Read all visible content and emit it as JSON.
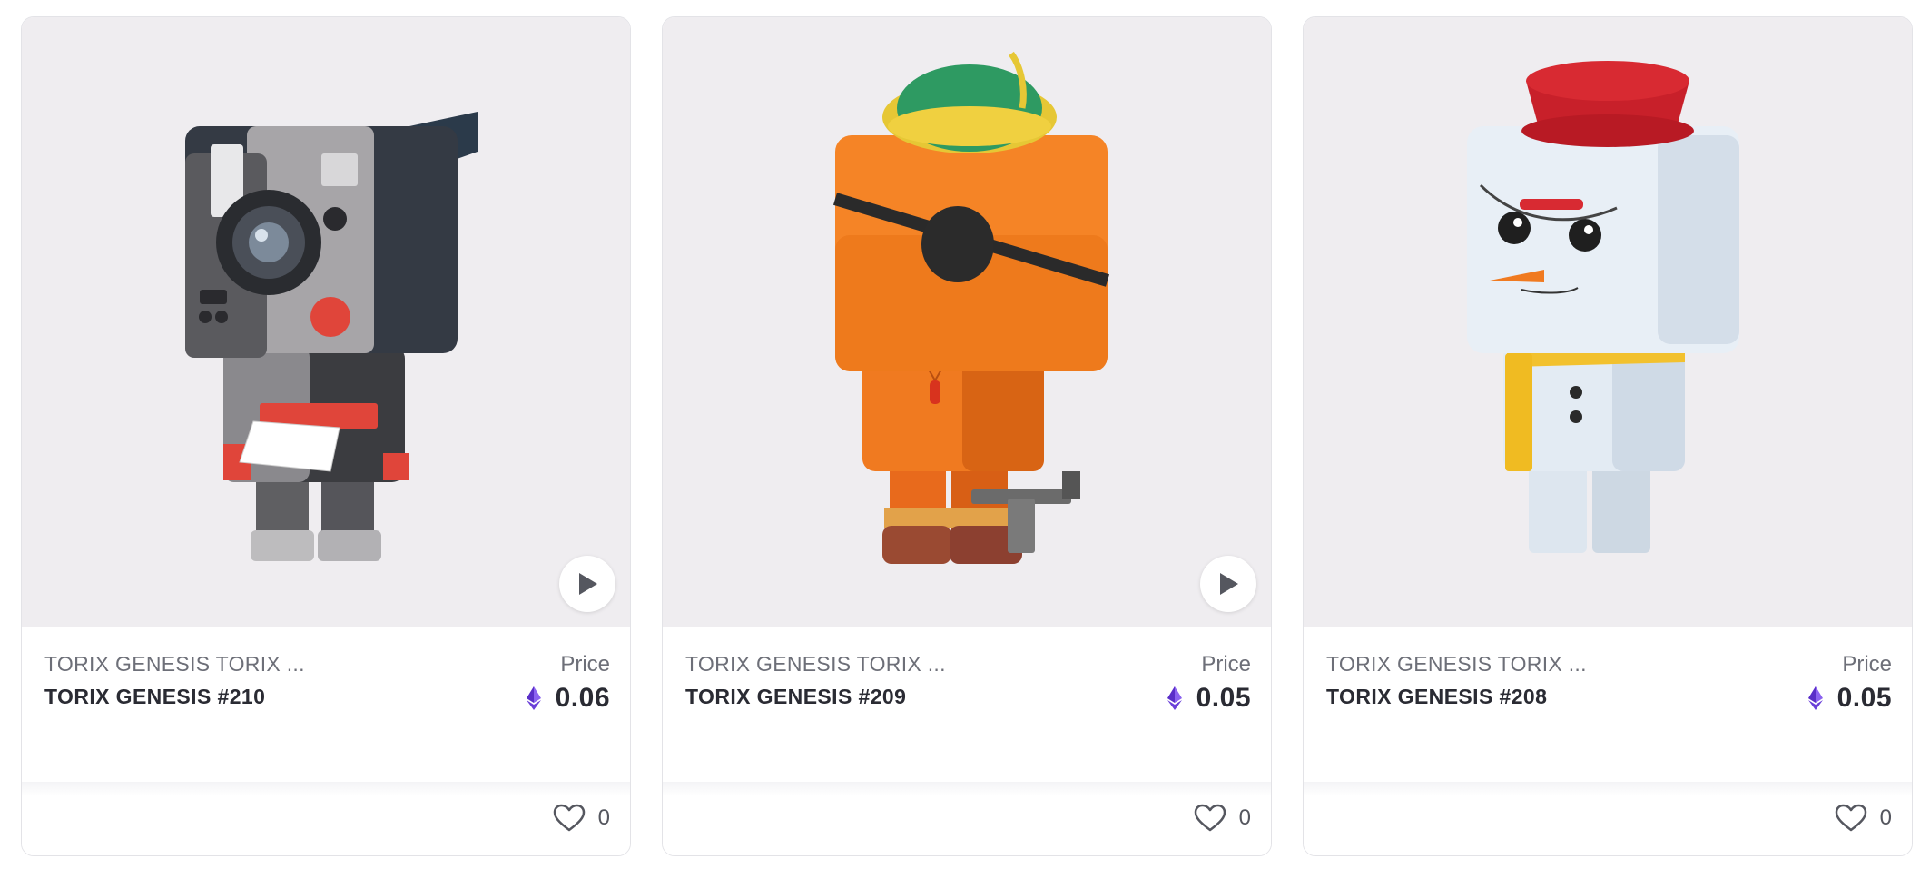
{
  "cards": [
    {
      "collection": "TORIX GENESIS TORIX ...",
      "token_name": "TORIX GENESIS #210",
      "price_label": "Price",
      "price": "0.06",
      "likes": "0",
      "has_play": true,
      "image": "camera-robot-figure"
    },
    {
      "collection": "TORIX GENESIS TORIX ...",
      "token_name": "TORIX GENESIS #209",
      "price_label": "Price",
      "price": "0.05",
      "likes": "0",
      "has_play": true,
      "image": "orange-pirate-figure"
    },
    {
      "collection": "TORIX GENESIS TORIX ...",
      "token_name": "TORIX GENESIS #208",
      "price_label": "Price",
      "price": "0.05",
      "likes": "0",
      "has_play": false,
      "image": "snowman-figure"
    }
  ],
  "icons": {
    "currency": "ethereum-icon",
    "like": "heart-icon",
    "play": "play-icon"
  },
  "colors": {
    "media_background": "#efedf0",
    "eth_purple": "#6a3fd8",
    "text_primary": "#2a2b33",
    "text_secondary": "#6d6f78"
  }
}
